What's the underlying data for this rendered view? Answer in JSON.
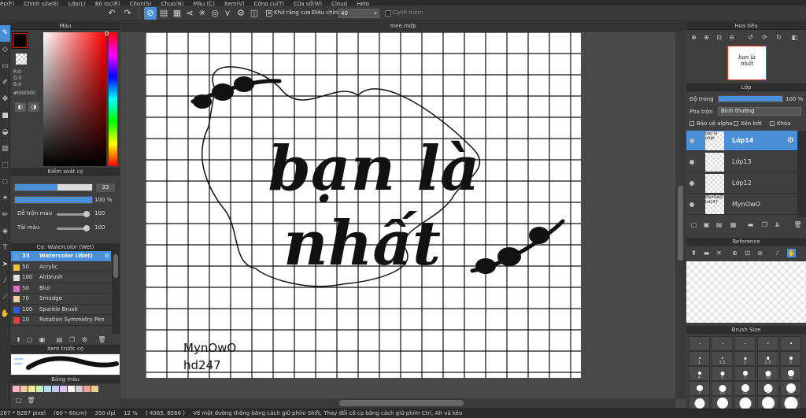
{
  "menu": [
    "ệp(F)",
    "Chỉnh sửa(E)",
    "Lớp(L)",
    "Bộ lọc(R)",
    "Chọn(S)",
    "Chụp(N)",
    "Màu (C)",
    "Xem(V)",
    "Công cụ(T)",
    "Cửa sổ(W)",
    "Cloud",
    "Help"
  ],
  "toolbar": {
    "antialias_label": "Khử răng cưa",
    "antialias_mark": "✕",
    "adjust_label": "Điều chỉnh",
    "adjust_value": "40",
    "edge_label": "Cạnh mềm"
  },
  "color_panel": {
    "title": "Màu",
    "r": "R:0",
    "g": "G:0",
    "b": "B:0",
    "hex": "#000000",
    "fg_color": "#000000"
  },
  "brush_control": {
    "title": "Kiểm soát cọ",
    "size_value": "33",
    "size_fraction": 0.55,
    "opacity_value": "100 %",
    "opacity_fraction": 1.0,
    "blend_label": "Dễ trộn màu",
    "blend_value": "100",
    "paint_label": "Tải màu",
    "paint_value": "100"
  },
  "brush_list": {
    "title": "Cọ: Watercolor (Wet)",
    "items": [
      {
        "num": "33",
        "name": "Watercolor (Wet)",
        "color": "#5aa0e0",
        "selected": true
      },
      {
        "num": "50",
        "name": "Acrylic",
        "color": "#f0c040"
      },
      {
        "num": "100",
        "name": "Airbrush",
        "color": "#e0e0e0"
      },
      {
        "num": "50",
        "name": "Blur",
        "color": "#e070c0"
      },
      {
        "num": "70",
        "name": "Smudge",
        "color": "#f0d0a0"
      },
      {
        "num": "100",
        "name": "Sparkle Brush",
        "color": "#3060e0"
      },
      {
        "num": "10",
        "name": "Rotation Symmetry Pen",
        "color": "#e04040"
      }
    ]
  },
  "preview": {
    "title": "Xem trước cọ"
  },
  "palette": {
    "title": "Bảng màu",
    "chips": [
      "#f4b6c2",
      "#f7c6a0",
      "#f7e6a0",
      "#c8f0c0",
      "#b0e0f0",
      "#c0c8f8",
      "#e0c0f0",
      "#ffffff",
      "#d0d0d0",
      "#f0a0a0",
      "#f0d090"
    ]
  },
  "document": {
    "title": "mee.mdp",
    "artwork_line1": "bạn là",
    "artwork_line2": "nhất",
    "signature_line1": "MynOwO",
    "signature_line2": "hd247"
  },
  "navigator": {
    "title": "Hoa tiêu",
    "thumb_line1": "bạn là",
    "thumb_line2": "nhất"
  },
  "layer_panel": {
    "title": "Lớp",
    "opacity_label": "Độ trong",
    "opacity_value": "100 %",
    "blend_label": "Pha trộn",
    "blend_value": "Bình thường",
    "protect_alpha": "Bảo vệ alpha",
    "clipping": "Xén bớt",
    "lock": "Khóa",
    "layers": [
      {
        "name": "Lớp14",
        "thumb": "bạn là nhất",
        "selected": true
      },
      {
        "name": "Lớp13",
        "thumb": "",
        "selected": false
      },
      {
        "name": "Lớp12",
        "thumb": "",
        "selected": false
      },
      {
        "name": "MynOwO",
        "thumb": "MynOwO hd247",
        "selected": false
      }
    ]
  },
  "reference": {
    "title": "Reference"
  },
  "brush_size": {
    "title": "Brush Size",
    "rows": [
      [
        "",
        "",
        "",
        "",
        ""
      ],
      [
        "1",
        "1.5",
        "2",
        "2.5",
        "3"
      ],
      [
        "4",
        "5",
        "7",
        "10",
        "12"
      ],
      [
        "7",
        "10",
        "12",
        "15",
        "20"
      ],
      [
        "",
        "",
        "",
        "",
        ""
      ]
    ]
  },
  "status": {
    "size": "267 * 8267 pixel",
    "physical": "(60 * 60cm)",
    "dpi": "350 dpi",
    "zoom": "12 %",
    "coords": "( 4365, 8566 )",
    "hint": "Vẽ một đường thẳng bằng cách giữ phím Shift, Thay đổi cỡ cọ bằng cách giữ phím Ctrl, Alt và kéo"
  }
}
